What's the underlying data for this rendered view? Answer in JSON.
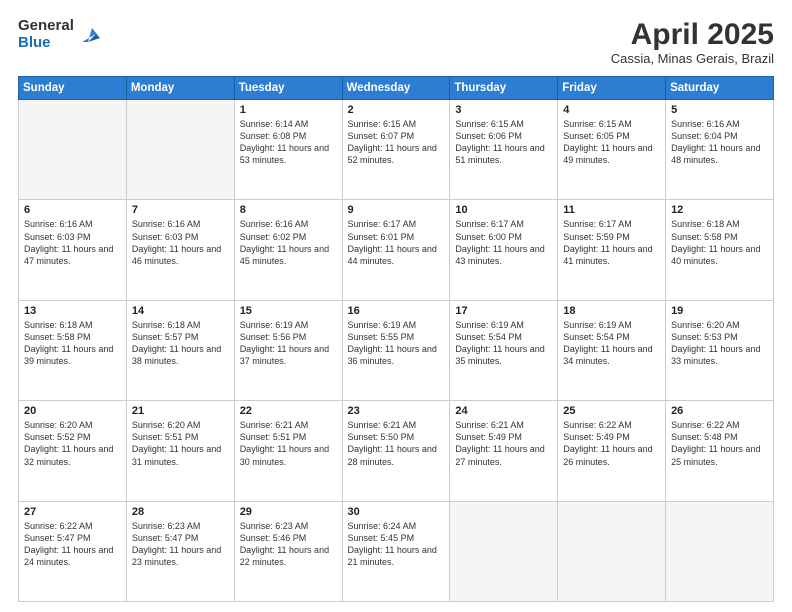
{
  "logo": {
    "general": "General",
    "blue": "Blue"
  },
  "header": {
    "month": "April 2025",
    "location": "Cassia, Minas Gerais, Brazil"
  },
  "weekdays": [
    "Sunday",
    "Monday",
    "Tuesday",
    "Wednesday",
    "Thursday",
    "Friday",
    "Saturday"
  ],
  "weeks": [
    [
      {
        "day": "",
        "info": ""
      },
      {
        "day": "",
        "info": ""
      },
      {
        "day": "1",
        "info": "Sunrise: 6:14 AM\nSunset: 6:08 PM\nDaylight: 11 hours and 53 minutes."
      },
      {
        "day": "2",
        "info": "Sunrise: 6:15 AM\nSunset: 6:07 PM\nDaylight: 11 hours and 52 minutes."
      },
      {
        "day": "3",
        "info": "Sunrise: 6:15 AM\nSunset: 6:06 PM\nDaylight: 11 hours and 51 minutes."
      },
      {
        "day": "4",
        "info": "Sunrise: 6:15 AM\nSunset: 6:05 PM\nDaylight: 11 hours and 49 minutes."
      },
      {
        "day": "5",
        "info": "Sunrise: 6:16 AM\nSunset: 6:04 PM\nDaylight: 11 hours and 48 minutes."
      }
    ],
    [
      {
        "day": "6",
        "info": "Sunrise: 6:16 AM\nSunset: 6:03 PM\nDaylight: 11 hours and 47 minutes."
      },
      {
        "day": "7",
        "info": "Sunrise: 6:16 AM\nSunset: 6:03 PM\nDaylight: 11 hours and 46 minutes."
      },
      {
        "day": "8",
        "info": "Sunrise: 6:16 AM\nSunset: 6:02 PM\nDaylight: 11 hours and 45 minutes."
      },
      {
        "day": "9",
        "info": "Sunrise: 6:17 AM\nSunset: 6:01 PM\nDaylight: 11 hours and 44 minutes."
      },
      {
        "day": "10",
        "info": "Sunrise: 6:17 AM\nSunset: 6:00 PM\nDaylight: 11 hours and 43 minutes."
      },
      {
        "day": "11",
        "info": "Sunrise: 6:17 AM\nSunset: 5:59 PM\nDaylight: 11 hours and 41 minutes."
      },
      {
        "day": "12",
        "info": "Sunrise: 6:18 AM\nSunset: 5:58 PM\nDaylight: 11 hours and 40 minutes."
      }
    ],
    [
      {
        "day": "13",
        "info": "Sunrise: 6:18 AM\nSunset: 5:58 PM\nDaylight: 11 hours and 39 minutes."
      },
      {
        "day": "14",
        "info": "Sunrise: 6:18 AM\nSunset: 5:57 PM\nDaylight: 11 hours and 38 minutes."
      },
      {
        "day": "15",
        "info": "Sunrise: 6:19 AM\nSunset: 5:56 PM\nDaylight: 11 hours and 37 minutes."
      },
      {
        "day": "16",
        "info": "Sunrise: 6:19 AM\nSunset: 5:55 PM\nDaylight: 11 hours and 36 minutes."
      },
      {
        "day": "17",
        "info": "Sunrise: 6:19 AM\nSunset: 5:54 PM\nDaylight: 11 hours and 35 minutes."
      },
      {
        "day": "18",
        "info": "Sunrise: 6:19 AM\nSunset: 5:54 PM\nDaylight: 11 hours and 34 minutes."
      },
      {
        "day": "19",
        "info": "Sunrise: 6:20 AM\nSunset: 5:53 PM\nDaylight: 11 hours and 33 minutes."
      }
    ],
    [
      {
        "day": "20",
        "info": "Sunrise: 6:20 AM\nSunset: 5:52 PM\nDaylight: 11 hours and 32 minutes."
      },
      {
        "day": "21",
        "info": "Sunrise: 6:20 AM\nSunset: 5:51 PM\nDaylight: 11 hours and 31 minutes."
      },
      {
        "day": "22",
        "info": "Sunrise: 6:21 AM\nSunset: 5:51 PM\nDaylight: 11 hours and 30 minutes."
      },
      {
        "day": "23",
        "info": "Sunrise: 6:21 AM\nSunset: 5:50 PM\nDaylight: 11 hours and 28 minutes."
      },
      {
        "day": "24",
        "info": "Sunrise: 6:21 AM\nSunset: 5:49 PM\nDaylight: 11 hours and 27 minutes."
      },
      {
        "day": "25",
        "info": "Sunrise: 6:22 AM\nSunset: 5:49 PM\nDaylight: 11 hours and 26 minutes."
      },
      {
        "day": "26",
        "info": "Sunrise: 6:22 AM\nSunset: 5:48 PM\nDaylight: 11 hours and 25 minutes."
      }
    ],
    [
      {
        "day": "27",
        "info": "Sunrise: 6:22 AM\nSunset: 5:47 PM\nDaylight: 11 hours and 24 minutes."
      },
      {
        "day": "28",
        "info": "Sunrise: 6:23 AM\nSunset: 5:47 PM\nDaylight: 11 hours and 23 minutes."
      },
      {
        "day": "29",
        "info": "Sunrise: 6:23 AM\nSunset: 5:46 PM\nDaylight: 11 hours and 22 minutes."
      },
      {
        "day": "30",
        "info": "Sunrise: 6:24 AM\nSunset: 5:45 PM\nDaylight: 11 hours and 21 minutes."
      },
      {
        "day": "",
        "info": ""
      },
      {
        "day": "",
        "info": ""
      },
      {
        "day": "",
        "info": ""
      }
    ]
  ]
}
